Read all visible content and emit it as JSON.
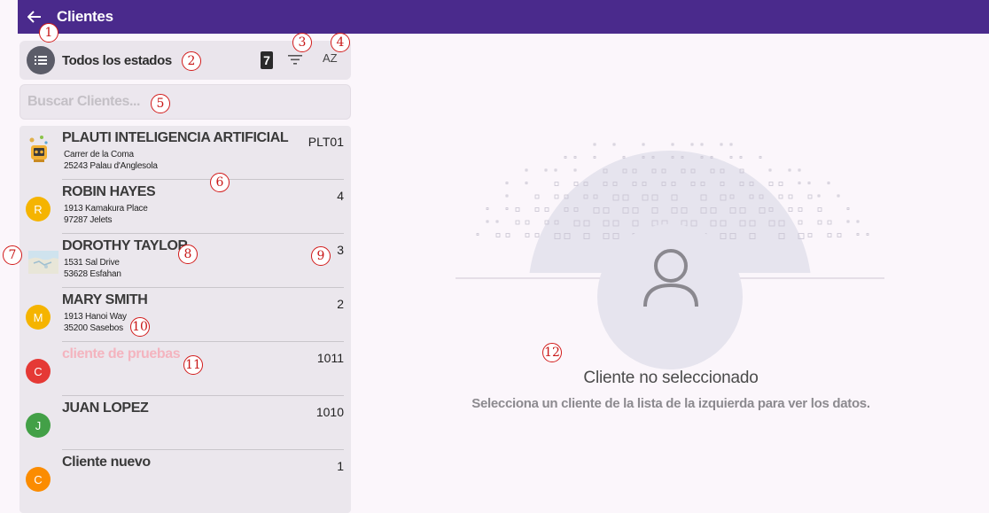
{
  "header": {
    "title": "Clientes",
    "back_icon": "arrow-left-icon",
    "color": "#4a2a8c"
  },
  "filter": {
    "label": "Todos los estados",
    "count": "7",
    "menu_icon": "list-icon",
    "filter_icon": "filter-icon",
    "sort_label": "AZ"
  },
  "search": {
    "placeholder": "Buscar Clientes...",
    "value": ""
  },
  "clients": [
    {
      "name": "PLAUTI INTELIGENCIA ARTIFICIAL",
      "address1": "Carrer de la Coma",
      "address2": "25243 Palau d'Anglesola",
      "code": "PLT01",
      "avatar": "robot-logo",
      "avatar_color": ""
    },
    {
      "name": "ROBIN HAYES",
      "address1": "1913 Kamakura Place",
      "address2": "97287 Jelets",
      "code": "4",
      "avatar": "R",
      "avatar_color": "#f5b400"
    },
    {
      "name": "DOROTHY TAYLOR",
      "address1": "1531 Sal Drive",
      "address2": "53628 Esfahan",
      "code": "3",
      "avatar": "map-thumbnail",
      "avatar_color": ""
    },
    {
      "name": "MARY SMITH",
      "address1": "1913 Hanoi Way",
      "address2": "35200 Sasebos",
      "code": "2",
      "avatar": "M",
      "avatar_color": "#f5b400"
    },
    {
      "name": "cliente de pruebas",
      "address1": "",
      "address2": "",
      "code": "1011",
      "avatar": "C",
      "avatar_color": "#e53935",
      "name_color": "#f4b4bf"
    },
    {
      "name": "JUAN LOPEZ",
      "address1": "",
      "address2": "",
      "code": "1010",
      "avatar": "J",
      "avatar_color": "#43a047"
    },
    {
      "name": "Cliente nuevo",
      "address1": "",
      "address2": "",
      "code": "1",
      "avatar": "C",
      "avatar_color": "#fb8c00"
    }
  ],
  "empty_state": {
    "title": "Cliente no seleccionado",
    "subtitle": "Selecciona un cliente de la lista de la izquierda para ver los datos.",
    "icon": "user-icon"
  },
  "annotations": [
    "1",
    "2",
    "3",
    "4",
    "5",
    "6",
    "7",
    "8",
    "9",
    "10",
    "11",
    "12"
  ]
}
